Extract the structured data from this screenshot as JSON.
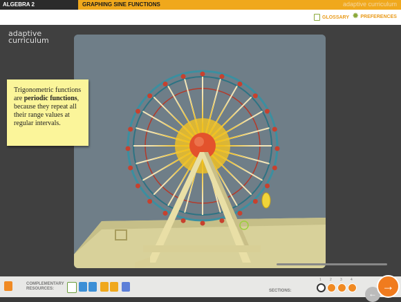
{
  "header": {
    "course": "ALGEBRA 2",
    "lesson": "GRAPHING SINE FUNCTIONS"
  },
  "toolbar": {
    "glossary": "GLOSSARY",
    "preferences": "PREFERENCES"
  },
  "brand": {
    "line1": "adaptive",
    "line2": "curriculum",
    "watermark": "adaptive curriculum"
  },
  "note": {
    "before": "Trigonometric functions are ",
    "bold": "periodic functions",
    "after": ", because they repeat all their range values at regular intervals."
  },
  "footer": {
    "resources_line1": "COMPLEMENTARY",
    "resources_line2": "RESOURCES:",
    "sections_label": "SECTIONS:",
    "section_numbers": [
      "1",
      "2",
      "3",
      "4"
    ]
  },
  "colors": {
    "accent": "#f0a81c",
    "next": "#f07b1e",
    "note": "#fbf59a"
  },
  "icons": [
    "glossary-icon",
    "preferences-gear-icon",
    "home-icon",
    "checklist-icon",
    "document-icon",
    "back-arrow-icon",
    "next-arrow-icon"
  ]
}
